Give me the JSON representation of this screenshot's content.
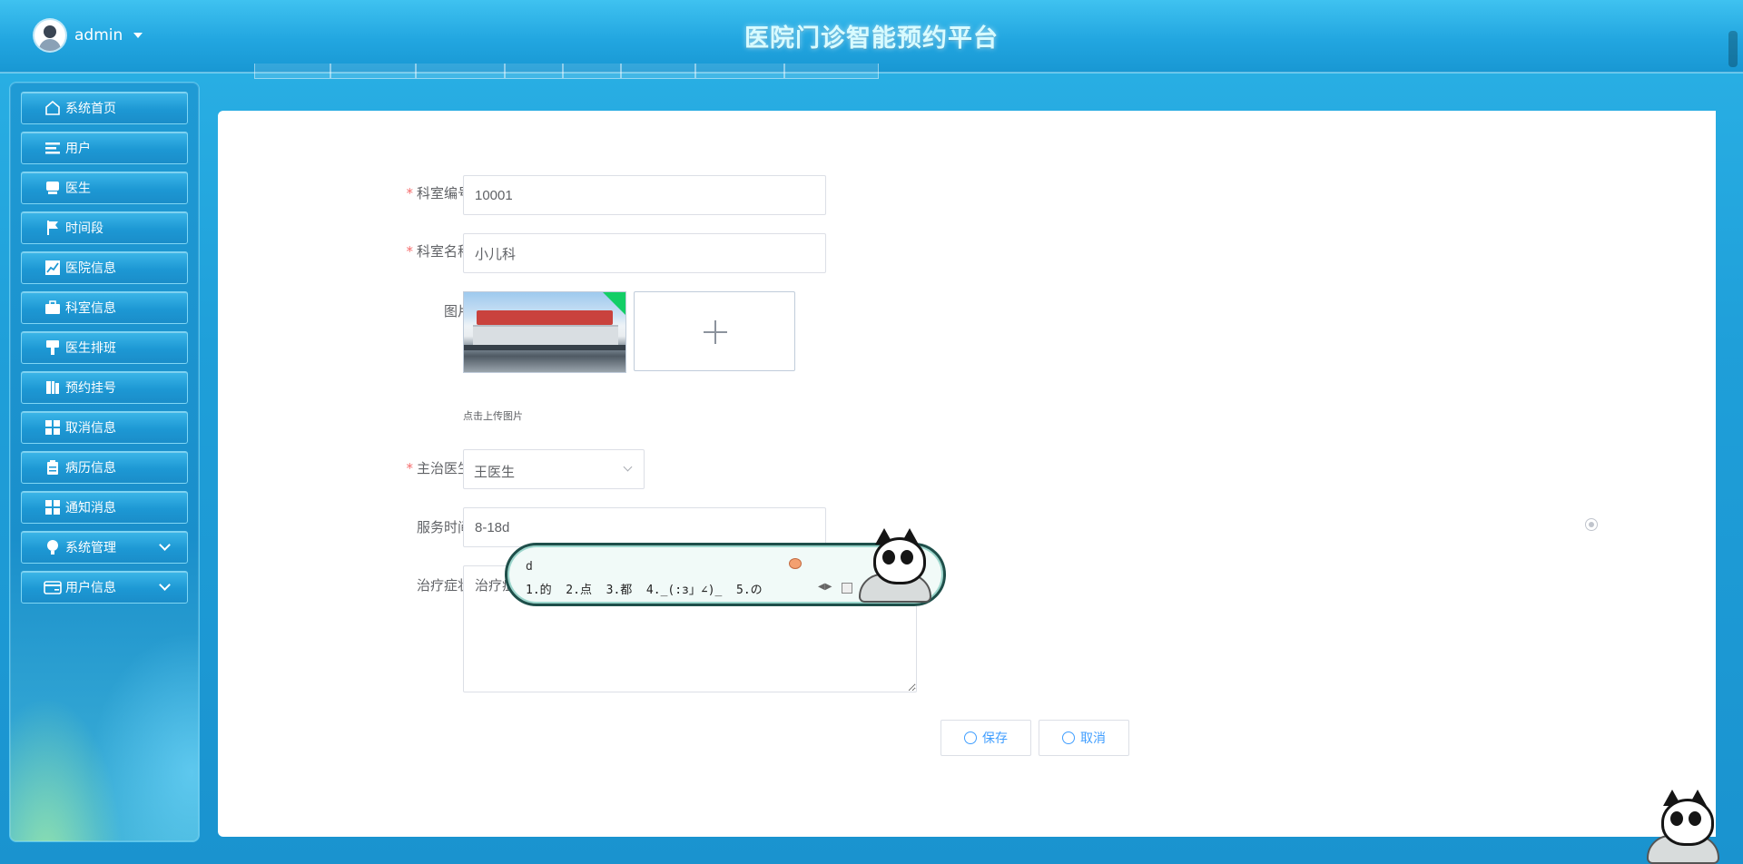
{
  "header": {
    "username": "admin",
    "title": "医院门诊智能预约平台"
  },
  "sidebar": {
    "items": [
      {
        "label": "系统首页",
        "icon": "home-icon"
      },
      {
        "label": "用户",
        "icon": "list-icon"
      },
      {
        "label": "医生",
        "icon": "monitor-icon"
      },
      {
        "label": "时间段",
        "icon": "flag-icon"
      },
      {
        "label": "医院信息",
        "icon": "chart-icon"
      },
      {
        "label": "科室信息",
        "icon": "briefcase-icon"
      },
      {
        "label": "医生排班",
        "icon": "brush-icon"
      },
      {
        "label": "预约挂号",
        "icon": "book-icon"
      },
      {
        "label": "取消信息",
        "icon": "grid-icon"
      },
      {
        "label": "病历信息",
        "icon": "clipboard-icon"
      },
      {
        "label": "通知消息",
        "icon": "grid-icon"
      },
      {
        "label": "系统管理",
        "icon": "bulb-icon",
        "expandable": true
      },
      {
        "label": "用户信息",
        "icon": "card-icon",
        "expandable": true
      }
    ]
  },
  "form": {
    "code": {
      "label": "科室编号",
      "value": "10001",
      "required": true
    },
    "name": {
      "label": "科室名称",
      "value": "小儿科",
      "required": true
    },
    "image": {
      "label": "图片",
      "hint": "点击上传图片"
    },
    "doctor": {
      "label": "主治医生",
      "value": "王医生",
      "required": true
    },
    "service_time": {
      "label": "服务时间",
      "value": "8-18d"
    },
    "symptoms": {
      "label": "治疗症状",
      "value": "治疗症"
    },
    "save_label": "保存",
    "cancel_label": "取消"
  },
  "ime": {
    "typed": "d",
    "candidates": "1.的  2.点  3.都  4._(:з」∠)_  5.の"
  }
}
